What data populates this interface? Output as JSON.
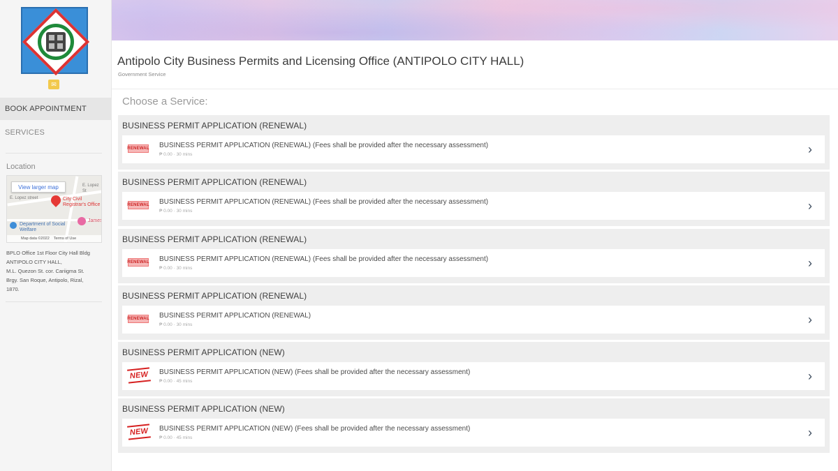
{
  "header": {
    "title": "Antipolo City Business Permits and Licensing Office (ANTIPOLO CITY HALL)",
    "subtitle": "Government Service"
  },
  "sidebar": {
    "mail_icon": "envelope-icon",
    "nav": [
      {
        "label": "BOOK APPOINTMENT",
        "active": true
      },
      {
        "label": "SERVICES",
        "active": false
      }
    ],
    "location": {
      "title": "Location",
      "map": {
        "view_larger": "View larger map",
        "place": "City Civil Registrar's Office",
        "dept": "Department of Social Welfare",
        "street1": "E. Lopez St",
        "street2": "E. Lopez street",
        "footer": "Map data ©2022",
        "terms": "Terms of Use",
        "extra": "James"
      },
      "address_lines": [
        "BPLO Office 1st Floor City Hall Bldg",
        "ANTIPOLO CITY HALL,",
        "M.L. Quezon St. cor. Cariigma St.",
        "Brgy. San Roque, Antipolo, Rizal,",
        "1870."
      ]
    }
  },
  "main": {
    "choose_label": "Choose a Service:",
    "groups": [
      {
        "title": "BUSINESS PERMIT APPLICATION (RENEWAL)",
        "badge": "RENEWAL",
        "badge_type": "renewal",
        "name": "BUSINESS PERMIT APPLICATION (RENEWAL) (Fees shall be provided after the necessary assessment)",
        "meta": "₱ 0.00 · 30 mins"
      },
      {
        "title": "BUSINESS PERMIT APPLICATION (RENEWAL)",
        "badge": "RENEWAL",
        "badge_type": "renewal",
        "name": "BUSINESS PERMIT APPLICATION (RENEWAL) (Fees shall be provided after the necessary assessment)",
        "meta": "₱ 0.00 · 30 mins"
      },
      {
        "title": "BUSINESS PERMIT APPLICATION (RENEWAL)",
        "badge": "RENEWAL",
        "badge_type": "renewal",
        "name": "BUSINESS PERMIT APPLICATION (RENEWAL) (Fees shall be provided after the necessary assessment)",
        "meta": "₱ 0.00 · 30 mins"
      },
      {
        "title": "BUSINESS PERMIT APPLICATION (RENEWAL)",
        "badge": "RENEWAL",
        "badge_type": "renewal",
        "name": "BUSINESS PERMIT APPLICATION (RENEWAL)",
        "meta": "₱ 0.00 · 30 mins"
      },
      {
        "title": "BUSINESS PERMIT APPLICATION (NEW)",
        "badge": "NEW",
        "badge_type": "new",
        "name": "BUSINESS PERMIT APPLICATION (NEW) (Fees shall be provided after the necessary assessment)",
        "meta": "₱ 0.00 · 45 mins"
      },
      {
        "title": "BUSINESS PERMIT APPLICATION (NEW)",
        "badge": "NEW",
        "badge_type": "new",
        "name": "BUSINESS PERMIT APPLICATION (NEW) (Fees shall be provided after the necessary assessment)",
        "meta": "₱ 0.00 · 45 mins"
      }
    ]
  }
}
